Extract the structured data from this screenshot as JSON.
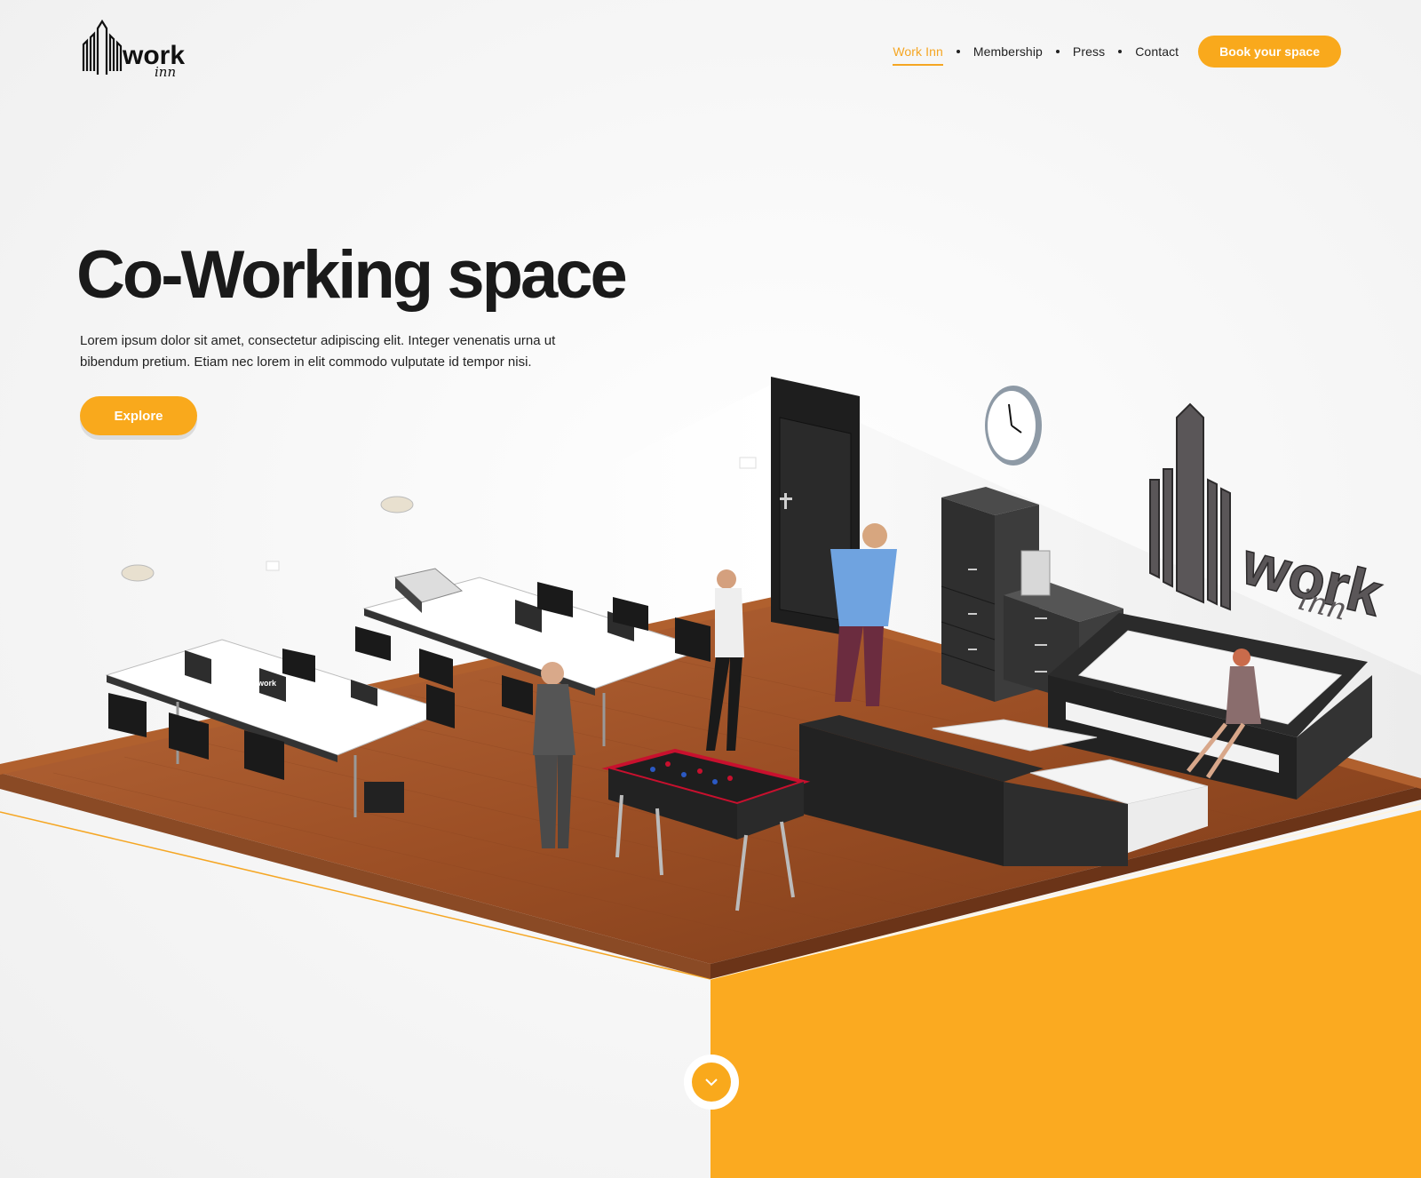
{
  "brand": {
    "logo_word": "work",
    "logo_sub": "inn"
  },
  "nav": {
    "items": [
      "Work Inn",
      "Membership",
      "Press",
      "Contact"
    ],
    "active_index": 0,
    "cta_label": "Book your space"
  },
  "hero": {
    "title": "Co-Working space",
    "description": "Lorem ipsum dolor sit amet, consectetur adipiscing elit. Integer venenatis urna ut bibendum pretium. Etiam nec lorem in elit commodo vulputate id tempor nisi.",
    "cta_label": "Explore"
  },
  "scene": {
    "laptop_label": "work",
    "wall_logo_word": "work",
    "wall_logo_sub": "inn"
  },
  "scroll": {
    "icon": "chevron-down-icon"
  },
  "colors": {
    "accent": "#f9a91c",
    "text": "#1a1a1a",
    "floor": "#a0522d"
  }
}
